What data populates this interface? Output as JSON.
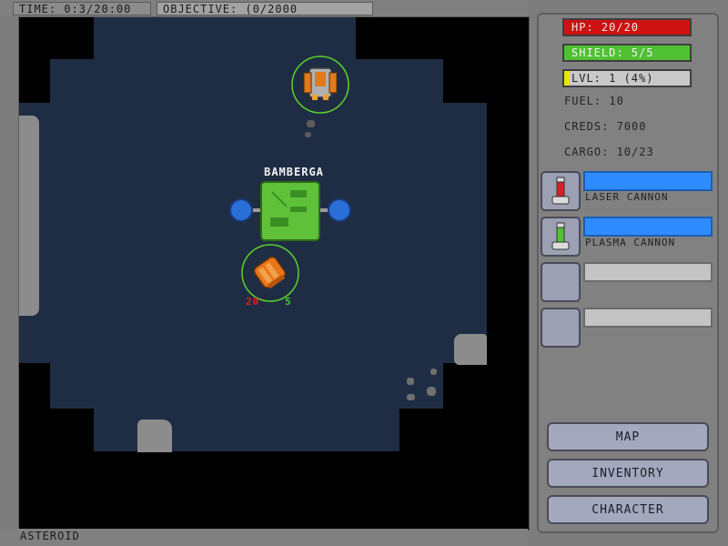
{
  "hud": {
    "time": "TIME: 0:3/20:00",
    "objective": "OBJECTIVE: (0/2000",
    "location": "ASTEROID"
  },
  "player": {
    "hp_label": "HP: 20/20",
    "shield_label": "SHIELD: 5/5",
    "level_label": "LVL: 1 (4%)",
    "level_progress": 0.04,
    "fuel": "FUEL: 10",
    "creds": "CREDS: 7000",
    "cargo": "CARGO: 10/23"
  },
  "weapons": [
    {
      "name": "LASER CANNON",
      "icon": "laser-cannon-icon",
      "charge": 1.0
    },
    {
      "name": "PLASMA CANNON",
      "icon": "plasma-cannon-icon",
      "charge": 1.0
    },
    {
      "name": "",
      "icon": "",
      "charge": 0
    },
    {
      "name": "",
      "icon": "",
      "charge": 0
    }
  ],
  "menu": {
    "map": "MAP",
    "inventory": "INVENTORY",
    "character": "CHARACTER"
  },
  "world": {
    "station_name": "BAMBERGA",
    "player_ship": {
      "hp": "20",
      "shield": "5"
    }
  },
  "colors": {
    "hp": "#cc1212",
    "shield": "#4fc132",
    "level": "#e6e600",
    "weapon_charge": "#2f8cff",
    "space": "#1f2d44"
  }
}
